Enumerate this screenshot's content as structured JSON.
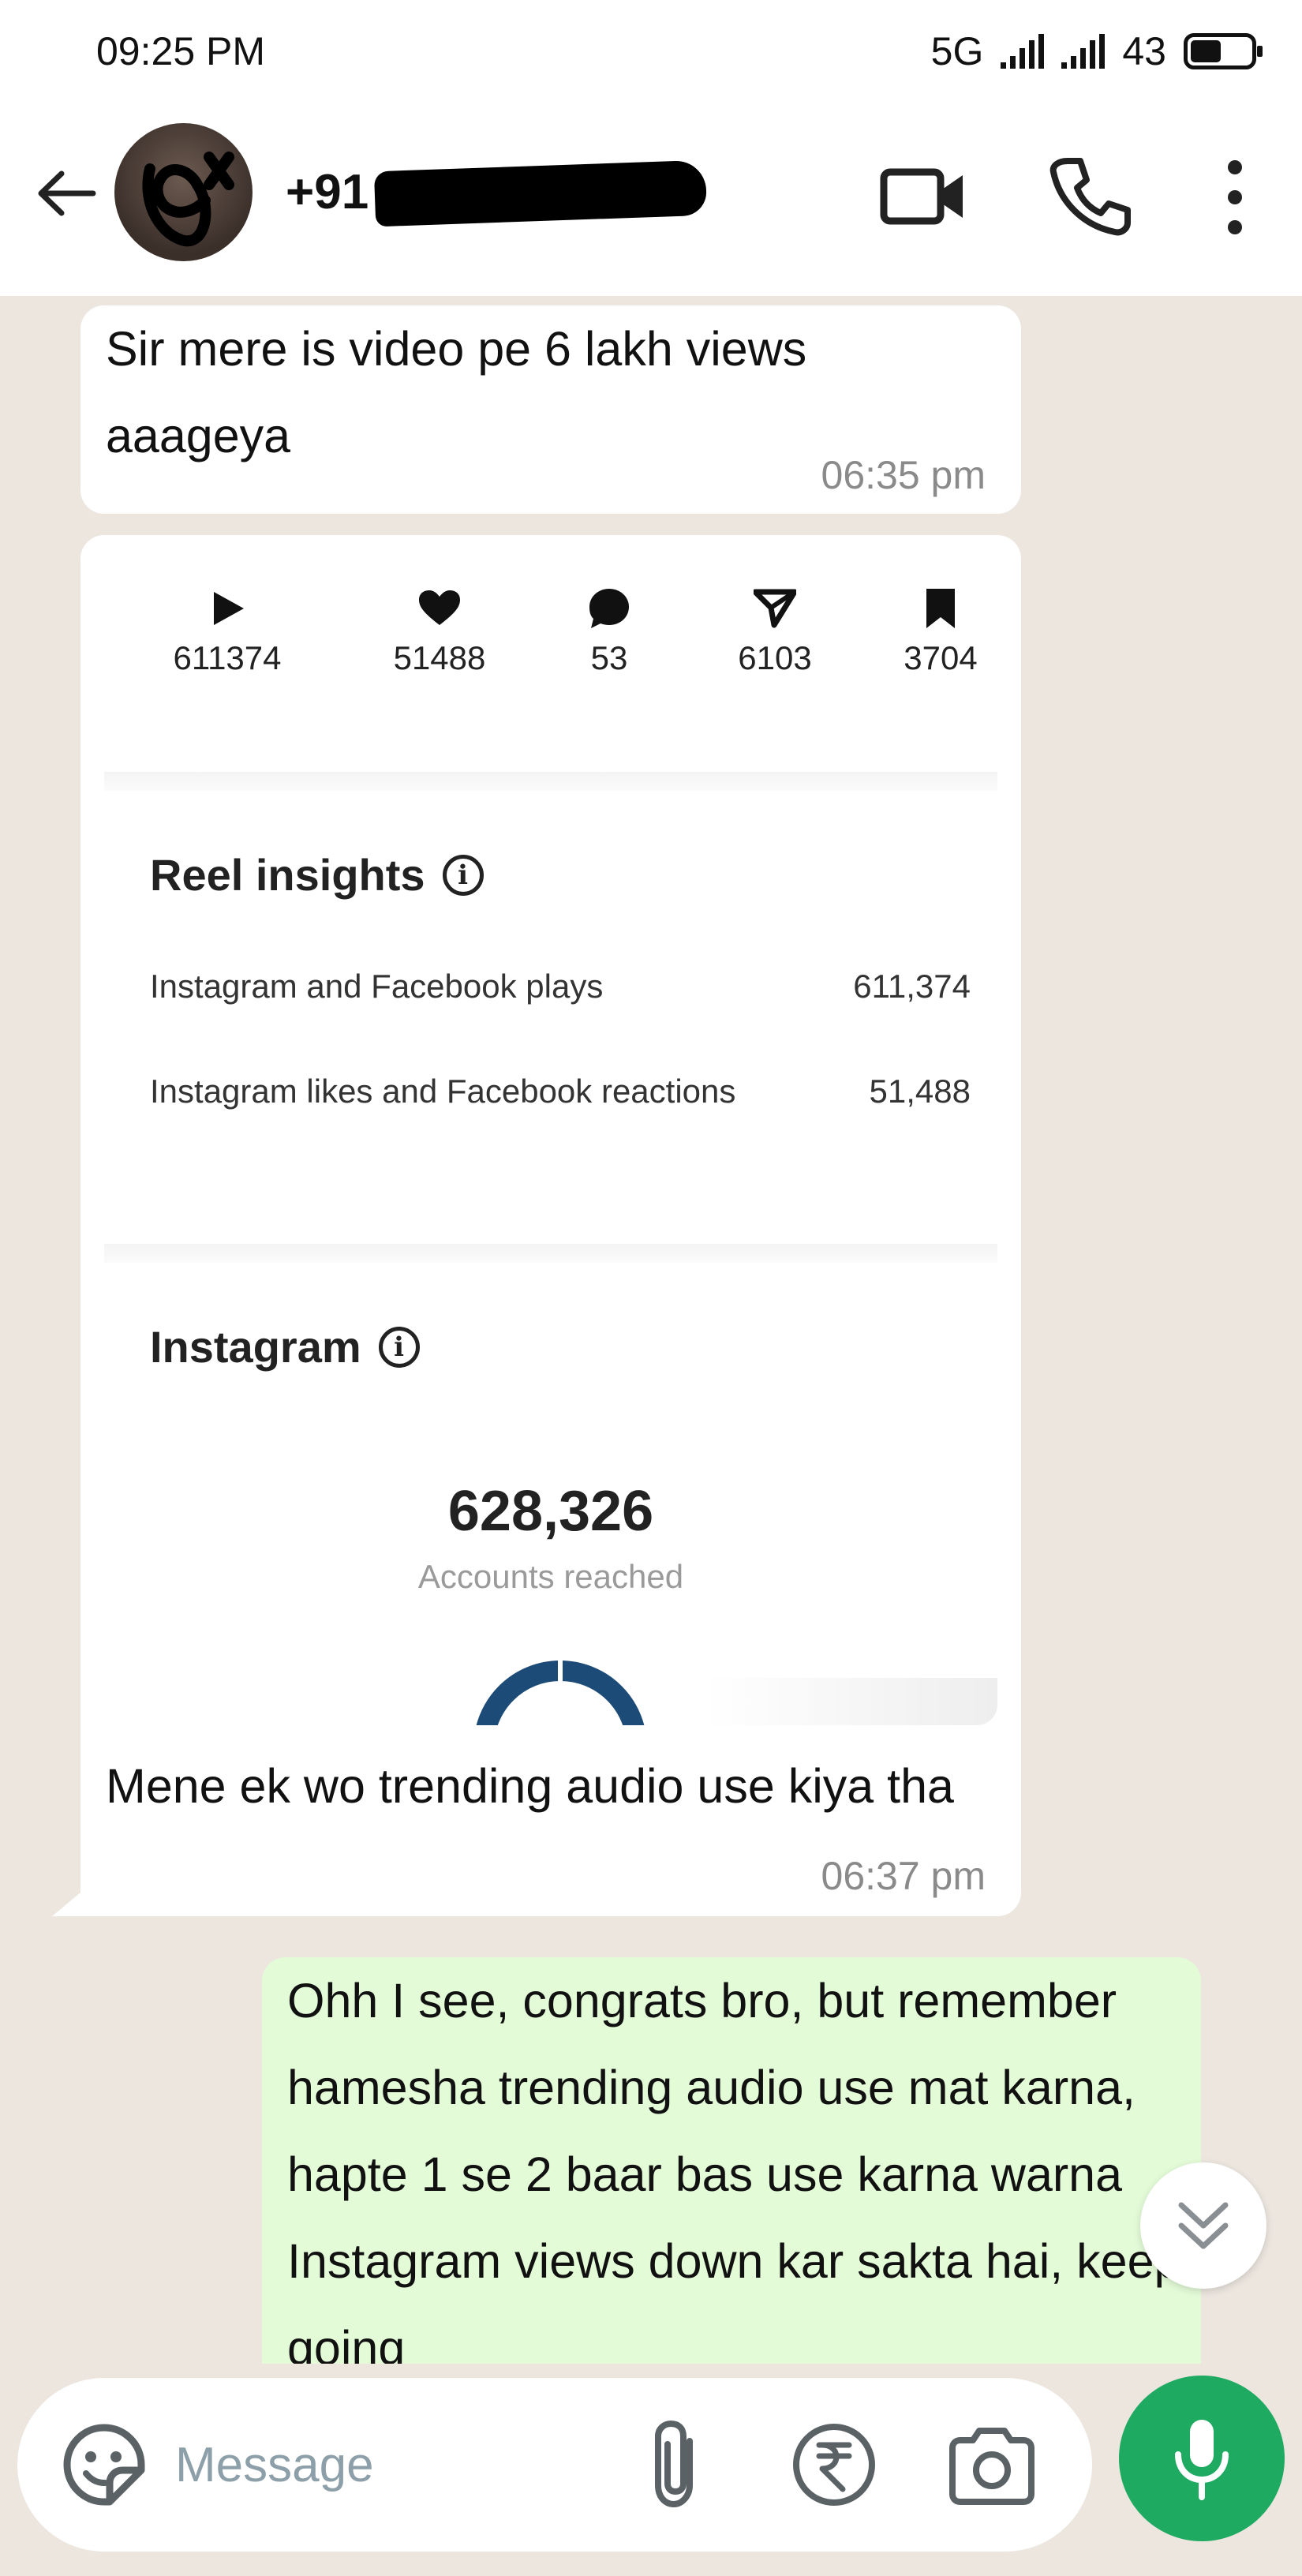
{
  "status_bar": {
    "time": "09:25 PM",
    "network": "5G",
    "battery": "43"
  },
  "header": {
    "contact_name": "+91",
    "icons": {
      "back": "back-arrow-icon",
      "video_call": "video-call-icon",
      "voice_call": "phone-icon",
      "menu": "more-vertical-icon"
    }
  },
  "messages": {
    "first": {
      "text": "Sir mere is video pe 6 lakh views aaageya",
      "time": "06:35 pm"
    },
    "second": {
      "text": "Mene ek wo trending audio use kiya tha",
      "time": "06:37 pm",
      "screenshot": {
        "stats": [
          {
            "icon": "play-icon",
            "value": "611374"
          },
          {
            "icon": "heart-icon",
            "value": "51488"
          },
          {
            "icon": "comment-icon",
            "value": "53"
          },
          {
            "icon": "share-icon",
            "value": "6103"
          },
          {
            "icon": "bookmark-icon",
            "value": "3704"
          }
        ],
        "reel_insights": {
          "title": "Reel insights",
          "rows": [
            {
              "label": "Instagram and Facebook plays",
              "value": "611,374"
            },
            {
              "label": "Instagram likes and Facebook reactions",
              "value": "51,488"
            }
          ]
        },
        "instagram": {
          "title": "Instagram",
          "reach_value": "628,326",
          "reach_label": "Accounts reached"
        }
      }
    },
    "outgoing": {
      "text": "Ohh I see, congrats bro, but remember hamesha trending audio use mat karna, hapte 1 se 2 baar bas use karna warna Instagram views down kar sakta hai, keep going"
    }
  },
  "footer": {
    "placeholder": "Message"
  },
  "colors": {
    "chat_background": "#ece6df",
    "incoming_bubble": "#ffffff",
    "outgoing_bubble": "#e4fbd8",
    "mic_button": "#1faa61",
    "timestamp": "#8a8a8a"
  }
}
